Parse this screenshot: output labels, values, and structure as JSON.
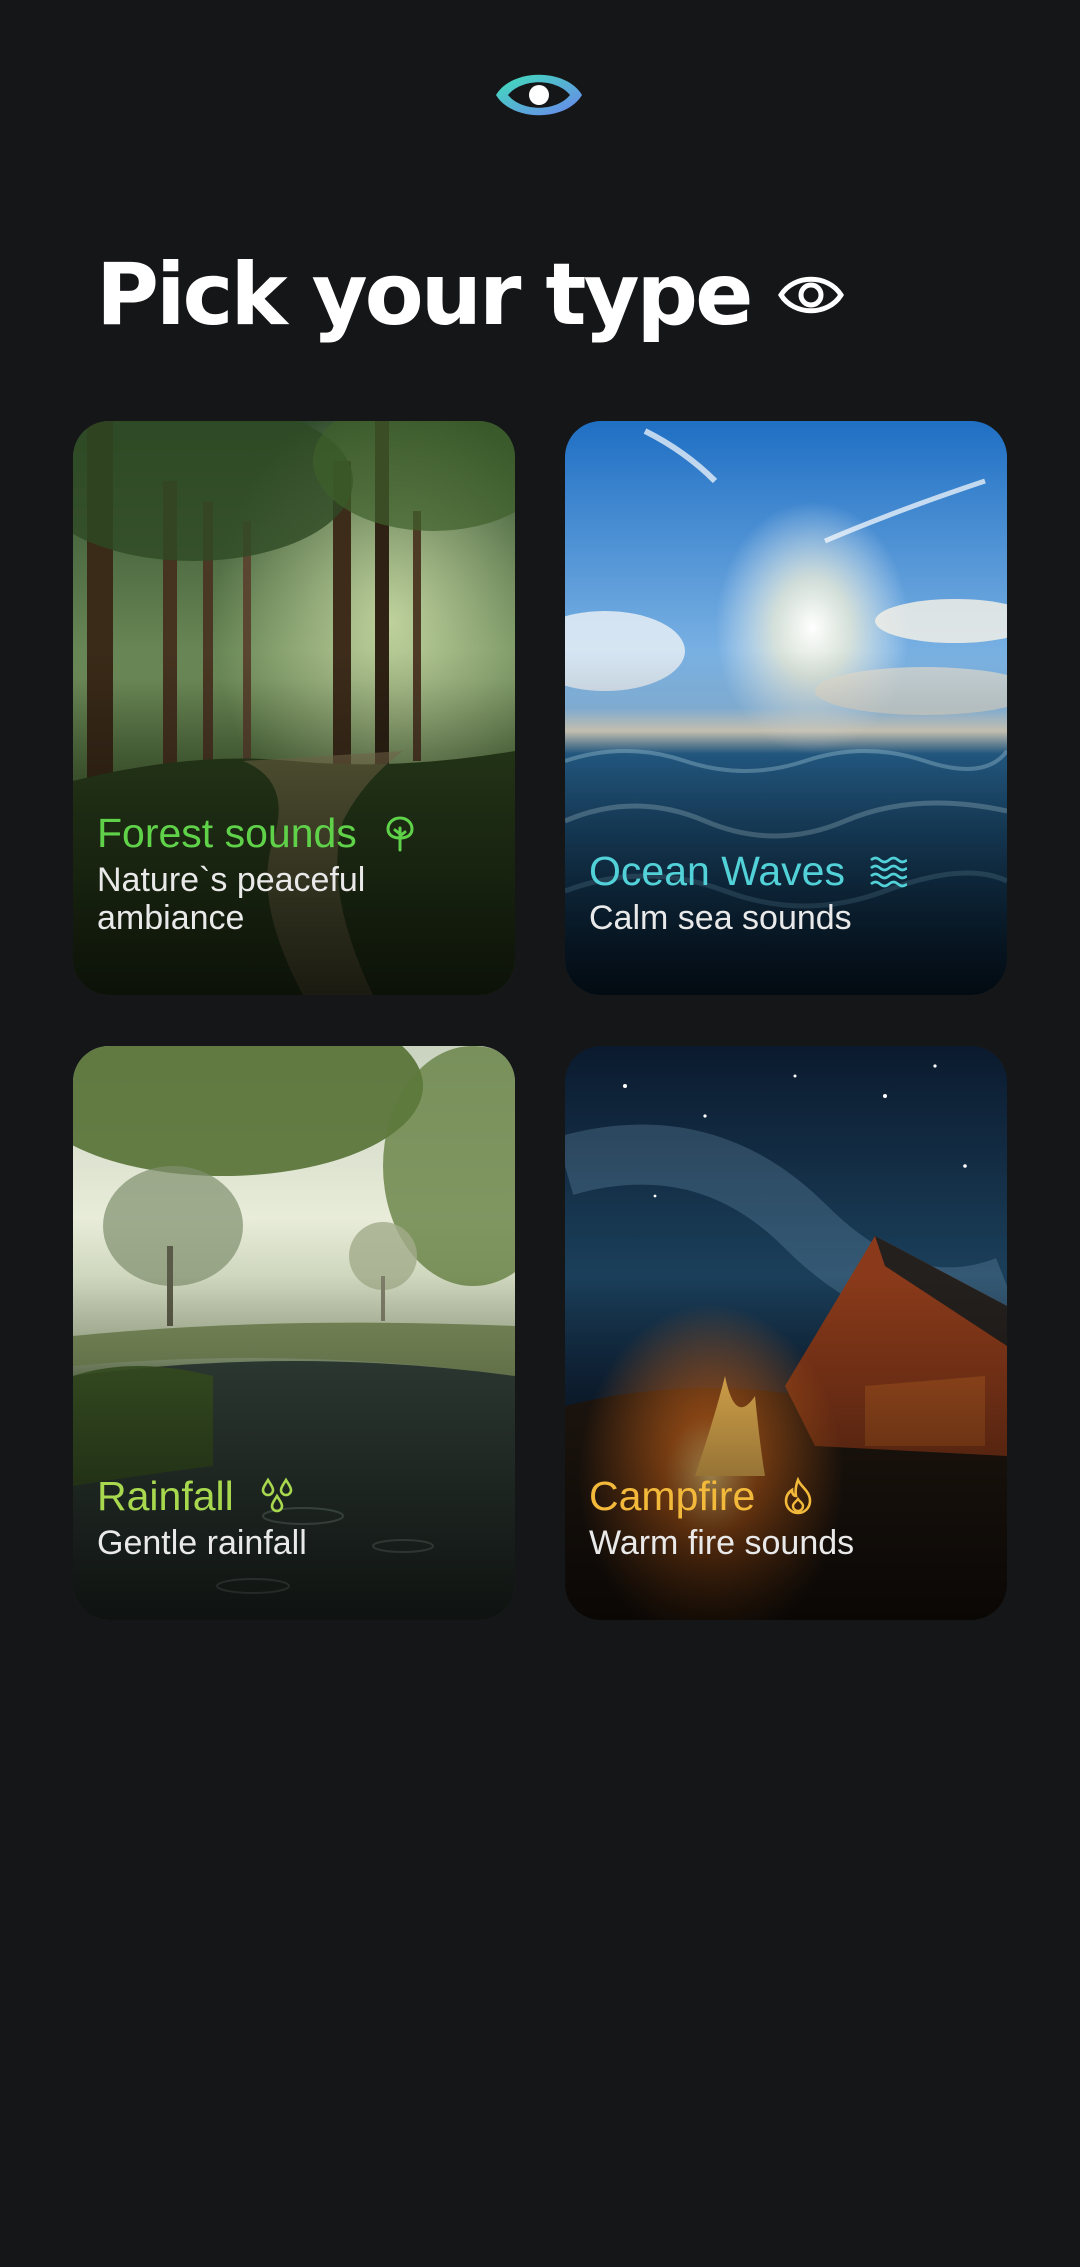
{
  "header": {
    "title": "Pick your type"
  },
  "colors": {
    "background": "#151618",
    "forest": "#5fd24a",
    "ocean": "#52d2d8",
    "rain": "#a8d84e",
    "fire": "#f2b93b"
  },
  "cards": [
    {
      "title": "Forest sounds",
      "subtitle_line1": "Nature`s peaceful",
      "subtitle_line2": "ambiance",
      "icon": "tree-icon"
    },
    {
      "title": "Ocean Waves",
      "subtitle": "Calm sea sounds",
      "icon": "waves-icon"
    },
    {
      "title": "Rainfall",
      "subtitle": "Gentle rainfall",
      "icon": "raindrops-icon"
    },
    {
      "title": "Campfire",
      "subtitle": "Warm fire sounds",
      "icon": "flame-icon"
    }
  ]
}
